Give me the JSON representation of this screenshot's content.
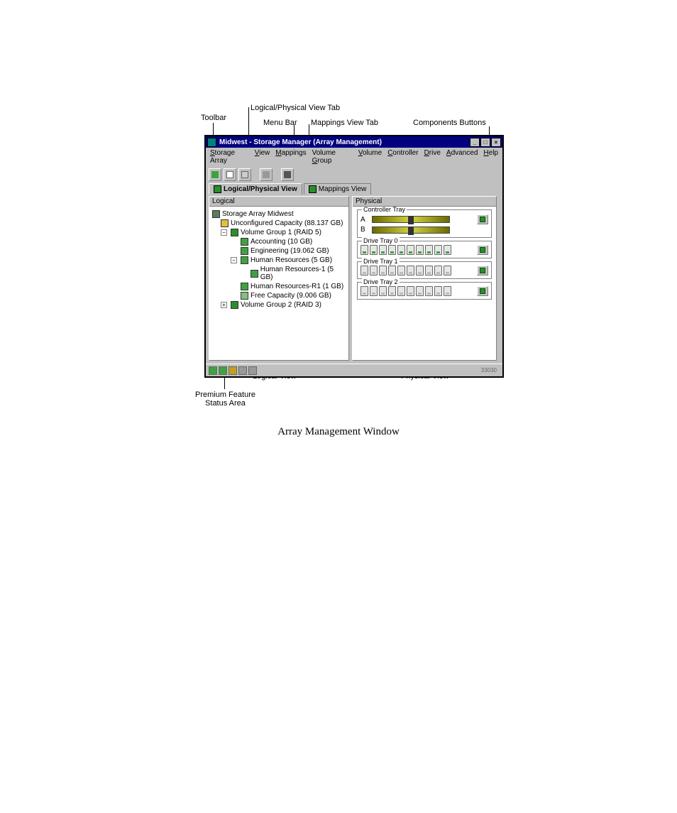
{
  "callouts": {
    "toolbar": "Toolbar",
    "lp_tab": "Logical/Physical View Tab",
    "menu_bar": "Menu Bar",
    "mappings_tab": "Mappings View Tab",
    "components_buttons": "Components Buttons",
    "logical_view": "Logical View",
    "physical_view": "Physical View",
    "premium_feature": "Premium Feature\nStatus Area"
  },
  "window": {
    "title": "Midwest - Storage Manager (Array Management)"
  },
  "menu": {
    "storage_array": "Storage Array",
    "view": "View",
    "mappings": "Mappings",
    "volume_group": "Volume Group",
    "volume": "Volume",
    "controller": "Controller",
    "drive": "Drive",
    "advanced": "Advanced",
    "help": "Help"
  },
  "tabs": {
    "logical_physical": "Logical/Physical View",
    "mappings": "Mappings View"
  },
  "panes": {
    "logical_header": "Logical",
    "physical_header": "Physical"
  },
  "tree": {
    "root": "Storage Array Midwest",
    "uncfg": "Unconfigured Capacity (88.137 GB)",
    "vg1": "Volume Group 1 (RAID 5)",
    "acct": "Accounting (10 GB)",
    "eng": "Engineering (19.062 GB)",
    "hr": "Human Resources (5 GB)",
    "hr1": "Human Resources-1 (5 GB)",
    "hrr1": "Human Resources-R1 (1 GB)",
    "free": "Free Capacity (9.006 GB)",
    "vg2": "Volume Group 2 (RAID 3)"
  },
  "physical": {
    "controller_tray": "Controller Tray",
    "ctrl_a": "A",
    "ctrl_b": "B",
    "drive_tray_0": "Drive Tray 0",
    "drive_tray_1": "Drive Tray 1",
    "drive_tray_2": "Drive Tray 2"
  },
  "status": {
    "code": "33030"
  },
  "caption": "Array Management Window"
}
